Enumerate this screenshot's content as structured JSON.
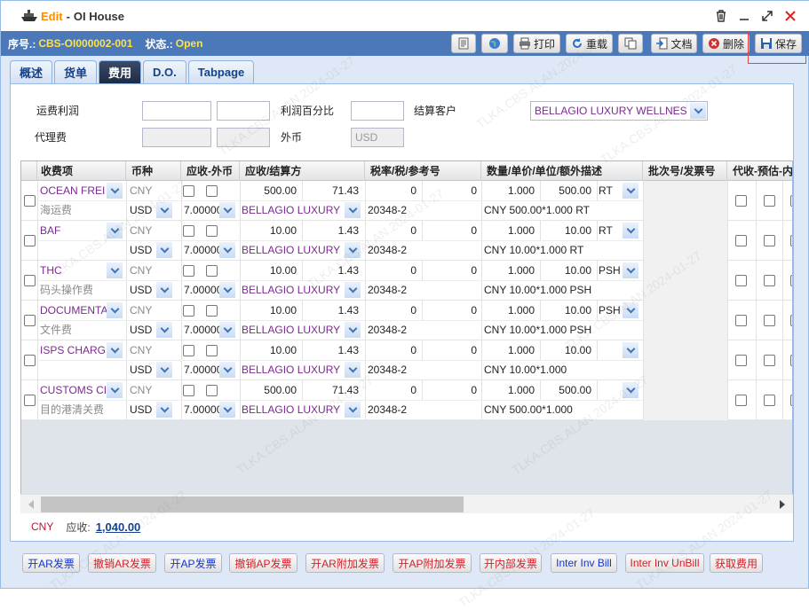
{
  "window": {
    "mode": "Edit",
    "separator": "-",
    "title": "OI House"
  },
  "info": {
    "serial_label": "序号.:",
    "serial_value": "CBS-OI000002-001",
    "status_label": "状态.:",
    "status_value": "Open"
  },
  "toolbar": {
    "print": "打印",
    "reload": "重载",
    "document": "文档",
    "delete": "删除",
    "save": "保存"
  },
  "tabs": [
    "概述",
    "货单",
    "费用",
    "D.O.",
    "Tabpage"
  ],
  "form": {
    "freight_profit_label": "运费利润",
    "profit_percent_label": "利润百分比",
    "settle_customer_label": "结算客户",
    "settle_customer_value": "BELLAGIO LUXURY WELLNES",
    "agent_fee_label": "代理费",
    "foreign_currency_label": "外币",
    "foreign_currency_value": "USD"
  },
  "grid": {
    "headers": [
      "收费项",
      "币种",
      "应收-外币",
      "应收/结算方",
      "税率/税/参考号",
      "数量/单价/单位/额外描述",
      "批次号/发票号",
      "代收-预估-内"
    ],
    "rows": [
      {
        "item": "OCEAN FREI",
        "desc": "海运费",
        "cur1": "CNY",
        "cur2": "USD",
        "rate": "7.00000",
        "amount": "500.00",
        "amount2": "71.43",
        "party": "BELLAGIO LUXURY",
        "tax1": "0",
        "tax2": "0",
        "ref": "20348-2",
        "qty": "1.000",
        "price": "500.00",
        "unit": "RT",
        "extra": "CNY 500.00*1.000 RT"
      },
      {
        "item": "BAF",
        "desc": "",
        "cur1": "CNY",
        "cur2": "USD",
        "rate": "7.00000",
        "amount": "10.00",
        "amount2": "1.43",
        "party": "BELLAGIO LUXURY",
        "tax1": "0",
        "tax2": "0",
        "ref": "20348-2",
        "qty": "1.000",
        "price": "10.00",
        "unit": "RT",
        "extra": "CNY 10.00*1.000 RT"
      },
      {
        "item": "THC",
        "desc": "码头操作费",
        "cur1": "CNY",
        "cur2": "USD",
        "rate": "7.00000",
        "amount": "10.00",
        "amount2": "1.43",
        "party": "BELLAGIO LUXURY",
        "tax1": "0",
        "tax2": "0",
        "ref": "20348-2",
        "qty": "1.000",
        "price": "10.00",
        "unit": "PSH",
        "extra": "CNY 10.00*1.000 PSH"
      },
      {
        "item": "DOCUMENTA",
        "desc": "文件费",
        "cur1": "CNY",
        "cur2": "USD",
        "rate": "7.00000",
        "amount": "10.00",
        "amount2": "1.43",
        "party": "BELLAGIO LUXURY",
        "tax1": "0",
        "tax2": "0",
        "ref": "20348-2",
        "qty": "1.000",
        "price": "10.00",
        "unit": "PSH",
        "extra": "CNY 10.00*1.000 PSH"
      },
      {
        "item": "ISPS CHARG",
        "desc": "",
        "cur1": "CNY",
        "cur2": "USD",
        "rate": "7.00000",
        "amount": "10.00",
        "amount2": "1.43",
        "party": "BELLAGIO LUXURY",
        "tax1": "0",
        "tax2": "0",
        "ref": "20348-2",
        "qty": "1.000",
        "price": "10.00",
        "unit": "",
        "extra": "CNY 10.00*1.000"
      },
      {
        "item": "CUSTOMS CI",
        "desc": "目的港清关费",
        "cur1": "CNY",
        "cur2": "USD",
        "rate": "7.00000",
        "amount": "500.00",
        "amount2": "71.43",
        "party": "BELLAGIO LUXURY",
        "tax1": "0",
        "tax2": "0",
        "ref": "20348-2",
        "qty": "1.000",
        "price": "500.00",
        "unit": "",
        "extra": "CNY 500.00*1.000"
      }
    ]
  },
  "summary": {
    "currency": "CNY",
    "receivable_label": "应收:",
    "receivable_value": "1,040.00"
  },
  "bottom_buttons": [
    {
      "label": "开AR发票",
      "color": "blue"
    },
    {
      "label": "撤销AR发票",
      "color": "red"
    },
    {
      "label": "开AP发票",
      "color": "blue"
    },
    {
      "label": "撤销AP发票",
      "color": "red"
    },
    {
      "label": "开AR附加发票",
      "color": "red"
    },
    {
      "label": "开AP附加发票",
      "color": "red"
    },
    {
      "label": "开内部发票",
      "color": "red"
    },
    {
      "label": "Inter Inv Bill",
      "color": "blue"
    },
    {
      "label": "Inter Inv UnBill",
      "color": "red"
    },
    {
      "label": "获取费用",
      "color": "red"
    }
  ],
  "watermark": "TLKA.CBS.ALAN.2024-01-27",
  "colors": {
    "header_bar": "#4a78b8",
    "status": "#ffe14a",
    "edit": "#ff8c00",
    "purple_text": "#7a2b8e",
    "active_tab": "#1e2b44"
  }
}
